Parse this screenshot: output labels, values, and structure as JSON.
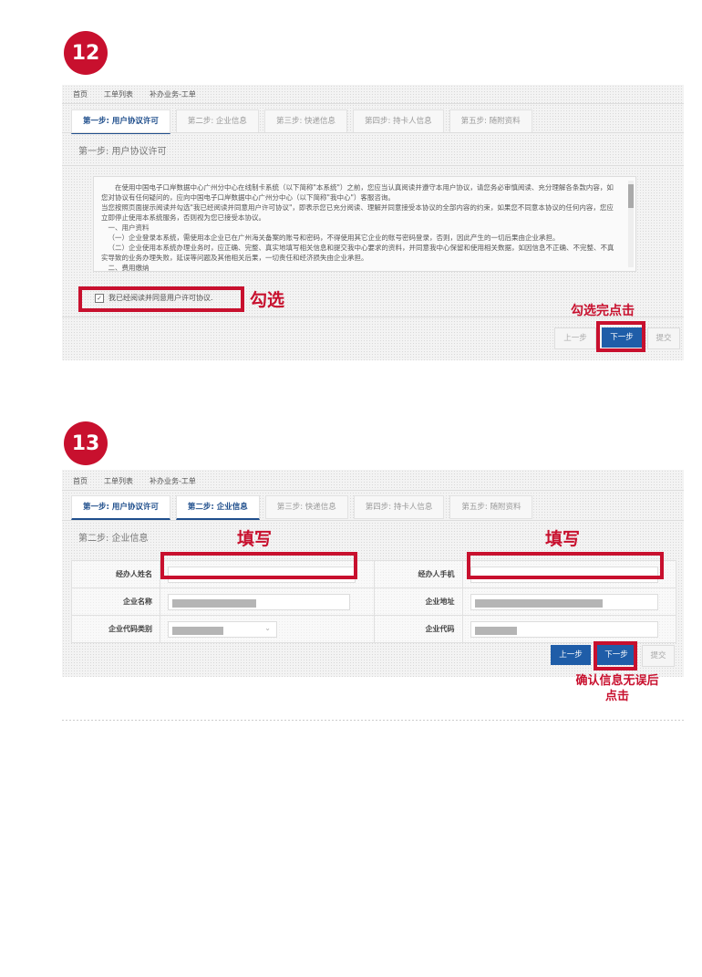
{
  "step12": {
    "badge": "12",
    "breadcrumb": [
      "首页",
      "工单列表",
      "补办业务-工单"
    ],
    "tabs": [
      "第一步: 用户协议许可",
      "第二步: 企业信息",
      "第三步: 快递信息",
      "第四步: 持卡人信息",
      "第五步: 随附资料"
    ],
    "section_title": "第一步: 用户协议许可",
    "agreement_lines": [
      "在使用中国电子口岸数据中心广州分中心在线制卡系统（以下简称\"本系统\"）之前，您应当认真阅读并遵守本用户协议，请您务必审慎阅读、充分理解各条款内容，如您对协议有任何疑问的，应向中国电子口岸数据中心广州分中心（以下简称\"我中心\"）客服咨询。",
      "当您按照页面提示阅读并勾选\"我已经阅读并同意用户许可协议\"，即表示您已充分阅读、理解并同意接受本协议的全部内容的约束，如果您不同意本协议的任何内容，您应立即停止使用本系统服务，否则视为您已接受本协议。",
      "一、用户资料",
      "（一）企业登录本系统，需使用本企业已在广州海关备案的账号和密码，不得使用其它企业的账号密码登录，否则，因此产生的一切后果由企业承担。",
      "（二）企业使用本系统办理业务时，应正确、完整、真实地填写相关信息和提交我中心要求的资料，并同意我中心保留和使用相关数据，如因信息不正确、不完整、不真实导致的业务办理失败，延误等问题及其他相关后果，一切责任和经济损失由企业承担。",
      "二、费用缴纳"
    ],
    "checkbox_label": "我已经阅读并同意用户许可协议.",
    "checkbox_checked": "✓",
    "annotation_check": "勾选",
    "annotation_next": "勾选完点击",
    "buttons": {
      "prev": "上一步",
      "next": "下一步",
      "submit": "提交"
    }
  },
  "step13": {
    "badge": "13",
    "breadcrumb": [
      "首页",
      "工单列表",
      "补办业务-工单"
    ],
    "tabs": [
      "第一步: 用户协议许可",
      "第二步: 企业信息",
      "第三步: 快递信息",
      "第四步: 持卡人信息",
      "第五步: 随附资料"
    ],
    "section_title": "第二步: 企业信息",
    "annotation_fill_left": "填写",
    "annotation_fill_right": "填写",
    "fields": {
      "agent_name": "经办人姓名",
      "agent_phone": "经办人手机",
      "company_name": "企业名称",
      "company_address": "企业地址",
      "code_type": "企业代码类别",
      "company_code": "企业代码"
    },
    "buttons": {
      "prev": "上一步",
      "next": "下一步",
      "submit": "提交"
    },
    "annotation_confirm_line1": "确认信息无误后",
    "annotation_confirm_line2": "点击"
  }
}
